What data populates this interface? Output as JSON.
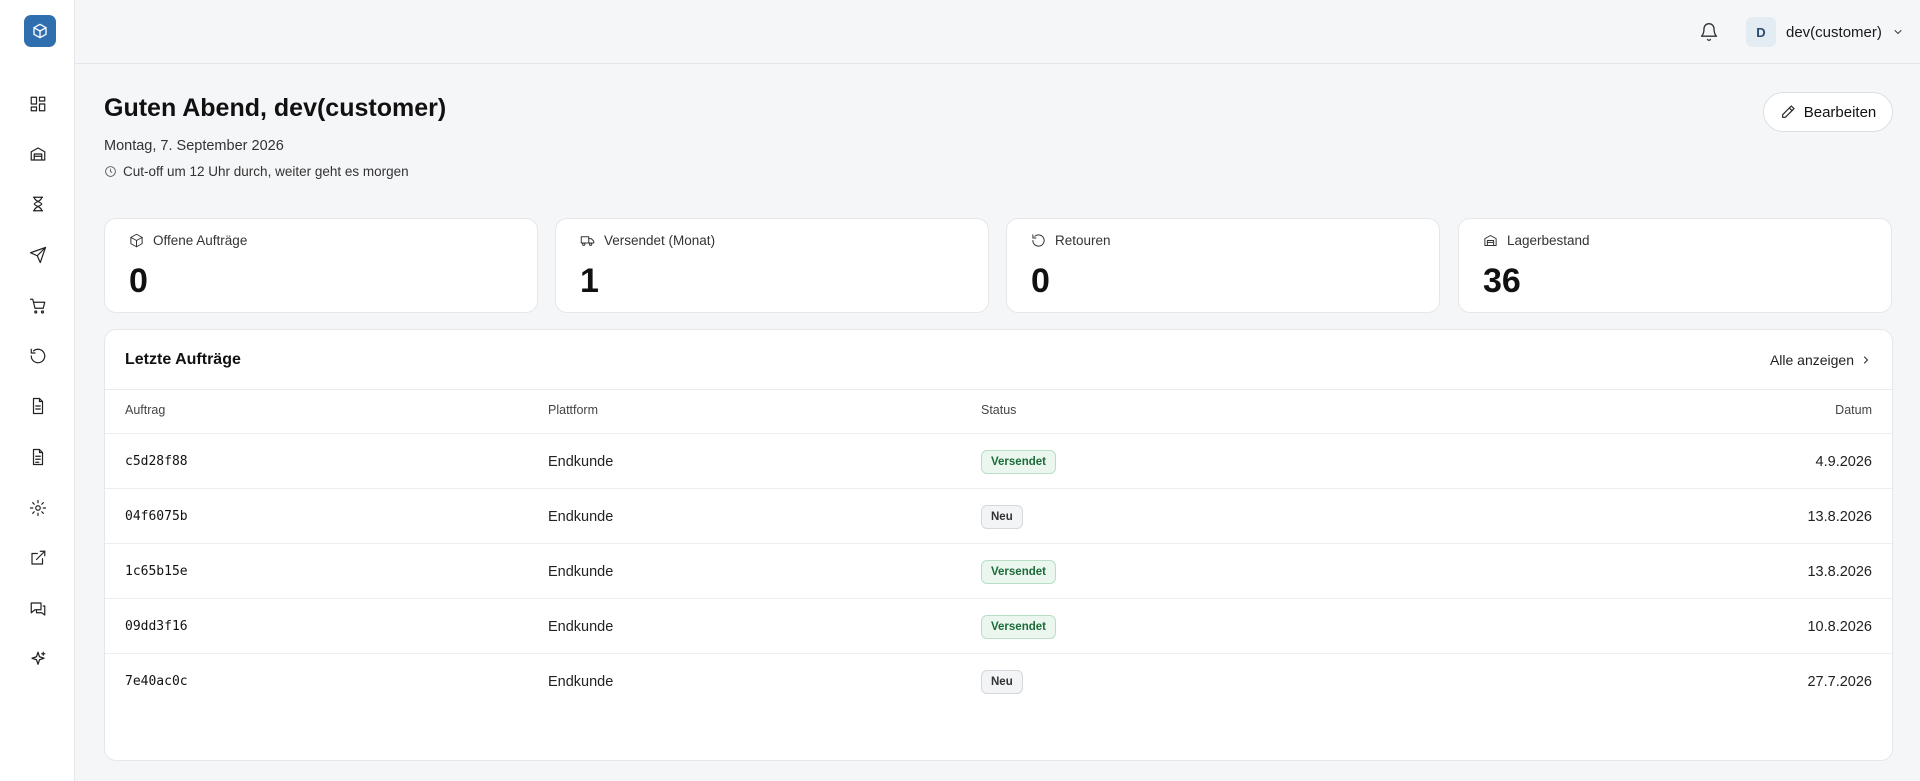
{
  "sidebar": {
    "logo_icon": "box-icon",
    "items": [
      {
        "name": "dashboard",
        "icon": "dashboard-icon"
      },
      {
        "name": "warehouse",
        "icon": "warehouse-icon"
      },
      {
        "name": "pending",
        "icon": "hourglass-icon"
      },
      {
        "name": "shipments",
        "icon": "send-icon"
      },
      {
        "name": "orders",
        "icon": "cart-icon"
      },
      {
        "name": "returns",
        "icon": "rotate-ccw-icon"
      },
      {
        "name": "documents",
        "icon": "document-icon"
      },
      {
        "name": "invoices",
        "icon": "file-text-icon"
      },
      {
        "name": "settings",
        "icon": "gear-icon"
      },
      {
        "name": "external",
        "icon": "external-link-icon"
      },
      {
        "name": "messages",
        "icon": "messages-icon"
      },
      {
        "name": "ai",
        "icon": "sparkles-icon"
      }
    ]
  },
  "header": {
    "user_initial": "D",
    "user_name": "dev(customer)"
  },
  "page": {
    "greeting": "Guten Abend, dev(customer)",
    "date": "Montag, 7. September 2026",
    "cutoff": "Cut-off um 12 Uhr durch, weiter geht es morgen",
    "edit_label": "Bearbeiten"
  },
  "stats": [
    {
      "label": "Offene Aufträge",
      "value": "0",
      "icon": "box-icon"
    },
    {
      "label": "Versendet (Monat)",
      "value": "1",
      "icon": "truck-icon"
    },
    {
      "label": "Retouren",
      "value": "0",
      "icon": "rotate-ccw-icon"
    },
    {
      "label": "Lagerbestand",
      "value": "36",
      "icon": "warehouse-icon"
    }
  ],
  "orders": {
    "title": "Letzte Aufträge",
    "show_all": "Alle anzeigen",
    "columns": [
      "Auftrag",
      "Plattform",
      "Status",
      "Datum"
    ],
    "rows": [
      {
        "id": "c5d28f88",
        "platform": "Endkunde",
        "status": "Versendet",
        "status_type": "shipped",
        "date": "4.9.2026"
      },
      {
        "id": "04f6075b",
        "platform": "Endkunde",
        "status": "Neu",
        "status_type": "new",
        "date": "13.8.2026"
      },
      {
        "id": "1c65b15e",
        "platform": "Endkunde",
        "status": "Versendet",
        "status_type": "shipped",
        "date": "13.8.2026"
      },
      {
        "id": "09dd3f16",
        "platform": "Endkunde",
        "status": "Versendet",
        "status_type": "shipped",
        "date": "10.8.2026"
      },
      {
        "id": "7e40ac0c",
        "platform": "Endkunde",
        "status": "Neu",
        "status_type": "new",
        "date": "27.7.2026"
      }
    ]
  },
  "colors": {
    "brand": "#2f6fb0",
    "background": "#f5f6f8",
    "shipped_badge": "#eaf6ee",
    "new_badge": "#f3f4f6"
  }
}
